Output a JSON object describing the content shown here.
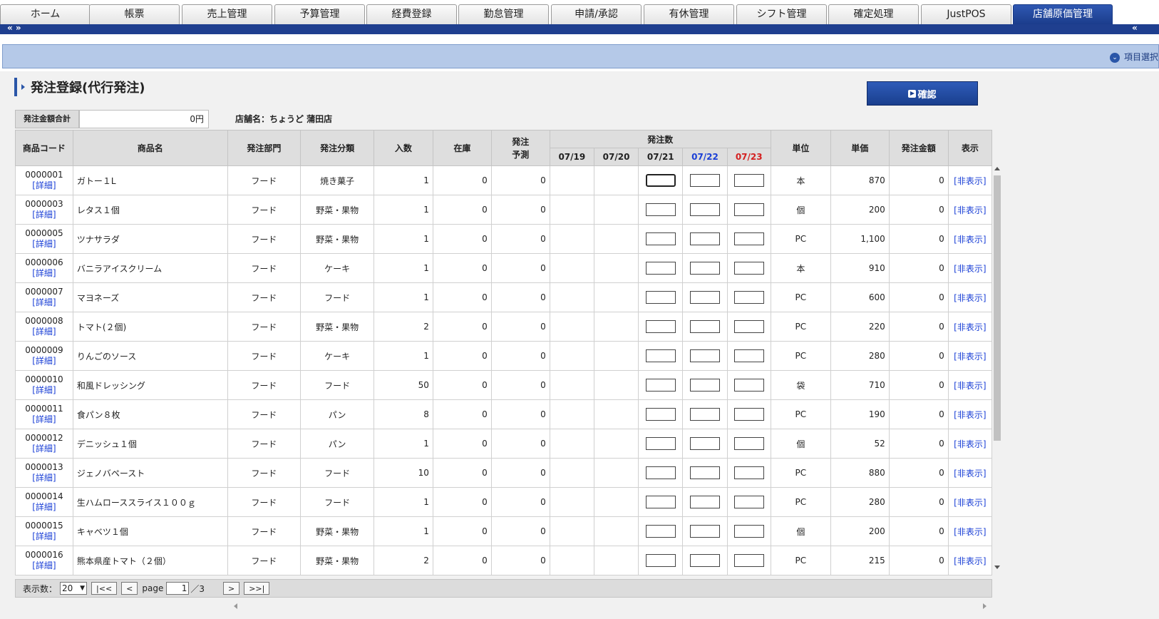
{
  "tabs": [
    {
      "label": "ホーム",
      "active": false
    },
    {
      "label": "帳票",
      "active": false
    },
    {
      "label": "売上管理",
      "active": false
    },
    {
      "label": "予算管理",
      "active": false
    },
    {
      "label": "経費登録",
      "active": false
    },
    {
      "label": "勤怠管理",
      "active": false
    },
    {
      "label": "申請/承認",
      "active": false
    },
    {
      "label": "有休管理",
      "active": false
    },
    {
      "label": "シフト管理",
      "active": false
    },
    {
      "label": "確定処理",
      "active": false
    },
    {
      "label": "JustPOS",
      "active": false
    },
    {
      "label": "店舗原価管理",
      "active": true
    }
  ],
  "subbar": {
    "left_arrows": "« »",
    "right_arrows": "«"
  },
  "strip": {
    "item_select": "項目選択"
  },
  "page": {
    "title": "発注登録(代行発注)",
    "confirm_label": "確認",
    "sum_label": "発注金額合計",
    "sum_value": "0円",
    "store_name": "店舗名：ちょうど 蒲田店"
  },
  "table": {
    "headers": {
      "code": "商品コード",
      "name": "商品名",
      "dept": "発注部門",
      "category": "発注分類",
      "pack": "入数",
      "stock": "在庫",
      "forecast_line1": "発注",
      "forecast_line2": "予測",
      "order_qty": "発注数",
      "unit": "単位",
      "price": "単価",
      "amount": "発注金額",
      "display": "表示"
    },
    "dates": [
      "07/19",
      "07/20",
      "07/21",
      "07/22",
      "07/23"
    ],
    "detail_label": "[詳細]",
    "hide_label": "[非表示]",
    "rows": [
      {
        "code": "0000001",
        "name": "ガトー１L",
        "dept": "フード",
        "category": "焼き菓子",
        "pack": "1",
        "stock": "0",
        "forecast": "0",
        "unit": "本",
        "price": "870",
        "amount": "0"
      },
      {
        "code": "0000003",
        "name": "レタス１個",
        "dept": "フード",
        "category": "野菜・果物",
        "pack": "1",
        "stock": "0",
        "forecast": "0",
        "unit": "個",
        "price": "200",
        "amount": "0"
      },
      {
        "code": "0000005",
        "name": "ツナサラダ",
        "dept": "フード",
        "category": "野菜・果物",
        "pack": "1",
        "stock": "0",
        "forecast": "0",
        "unit": "PC",
        "price": "1,100",
        "amount": "0"
      },
      {
        "code": "0000006",
        "name": "バニラアイスクリーム",
        "dept": "フード",
        "category": "ケーキ",
        "pack": "1",
        "stock": "0",
        "forecast": "0",
        "unit": "本",
        "price": "910",
        "amount": "0"
      },
      {
        "code": "0000007",
        "name": "マヨネーズ",
        "dept": "フード",
        "category": "フード",
        "pack": "1",
        "stock": "0",
        "forecast": "0",
        "unit": "PC",
        "price": "600",
        "amount": "0"
      },
      {
        "code": "0000008",
        "name": "トマト(２個)",
        "dept": "フード",
        "category": "野菜・果物",
        "pack": "2",
        "stock": "0",
        "forecast": "0",
        "unit": "PC",
        "price": "220",
        "amount": "0"
      },
      {
        "code": "0000009",
        "name": "りんごのソース",
        "dept": "フード",
        "category": "ケーキ",
        "pack": "1",
        "stock": "0",
        "forecast": "0",
        "unit": "PC",
        "price": "280",
        "amount": "0"
      },
      {
        "code": "0000010",
        "name": "和風ドレッシング",
        "dept": "フード",
        "category": "フード",
        "pack": "50",
        "stock": "0",
        "forecast": "0",
        "unit": "袋",
        "price": "710",
        "amount": "0"
      },
      {
        "code": "0000011",
        "name": "食パン８枚",
        "dept": "フード",
        "category": "パン",
        "pack": "8",
        "stock": "0",
        "forecast": "0",
        "unit": "PC",
        "price": "190",
        "amount": "0"
      },
      {
        "code": "0000012",
        "name": "デニッシュ１個",
        "dept": "フード",
        "category": "パン",
        "pack": "1",
        "stock": "0",
        "forecast": "0",
        "unit": "個",
        "price": "52",
        "amount": "0"
      },
      {
        "code": "0000013",
        "name": "ジェノバペースト",
        "dept": "フード",
        "category": "フード",
        "pack": "10",
        "stock": "0",
        "forecast": "0",
        "unit": "PC",
        "price": "880",
        "amount": "0"
      },
      {
        "code": "0000014",
        "name": "生ハムローススライス１００ｇ",
        "dept": "フード",
        "category": "フード",
        "pack": "1",
        "stock": "0",
        "forecast": "0",
        "unit": "PC",
        "price": "280",
        "amount": "0"
      },
      {
        "code": "0000015",
        "name": "キャベツ１個",
        "dept": "フード",
        "category": "野菜・果物",
        "pack": "1",
        "stock": "0",
        "forecast": "0",
        "unit": "個",
        "price": "200",
        "amount": "0"
      },
      {
        "code": "0000016",
        "name": "熊本県産トマト（２個）",
        "dept": "フード",
        "category": "野菜・果物",
        "pack": "2",
        "stock": "0",
        "forecast": "0",
        "unit": "PC",
        "price": "215",
        "amount": "0"
      }
    ]
  },
  "pager": {
    "display_count_label": "表示数：",
    "display_count": "20",
    "first": "|<<",
    "prev": "<",
    "page_label": "page",
    "page": "1",
    "total": "／3",
    "next": ">",
    "last": ">>|"
  },
  "colors": {
    "accent": "#1f3f8f",
    "date_blue": "#1a3fd6",
    "date_red": "#d42020",
    "link": "#1a3fd6"
  }
}
